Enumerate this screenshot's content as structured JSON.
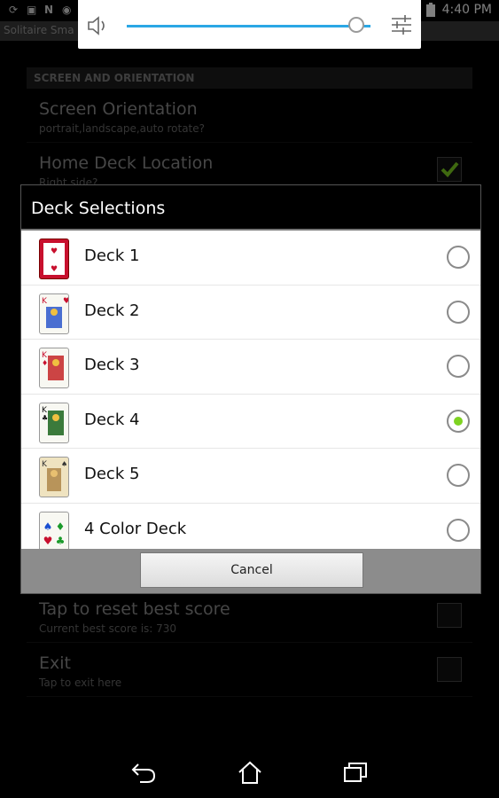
{
  "status_bar": {
    "time": "4:40 PM",
    "icons": [
      "sync-icon",
      "image-icon",
      "n-icon",
      "location-icon",
      "email-icon",
      "wifi-icon",
      "battery-icon"
    ]
  },
  "app": {
    "title": "Solitaire Sma"
  },
  "volume_panel": {
    "level": 0.9,
    "accent": "#2ba7e5",
    "icons": [
      "speaker-icon",
      "equalizer-settings-icon"
    ]
  },
  "background_settings": {
    "section_header": "SCREEN AND ORIENTATION",
    "items": [
      {
        "title": "Screen Orientation",
        "subtitle": "portrait,landscape,auto rotate?",
        "has_checkbox": false
      },
      {
        "title": "Home Deck Location",
        "subtitle": "Right side?",
        "has_checkbox": true,
        "checked": true
      },
      {
        "title": "Tap to reset best score",
        "subtitle": "Current best score is: 730",
        "has_checkbox": true,
        "checked": false
      },
      {
        "title": "Exit",
        "subtitle": "Tap to exit here",
        "has_checkbox": true,
        "checked": false
      }
    ]
  },
  "dialog": {
    "title": "Deck Selections",
    "decks": [
      {
        "label": "Deck 1",
        "selected": false,
        "card_icon": "card-hearts-icon"
      },
      {
        "label": "Deck 2",
        "selected": false,
        "card_icon": "card-king-icon"
      },
      {
        "label": "Deck 3",
        "selected": false,
        "card_icon": "card-king-icon"
      },
      {
        "label": "Deck 4",
        "selected": true,
        "card_icon": "card-king-clubs-icon"
      },
      {
        "label": "Deck 5",
        "selected": false,
        "card_icon": "card-king-vintage-icon"
      },
      {
        "label": "4 Color Deck",
        "selected": false,
        "card_icon": "card-four-color-icon"
      }
    ],
    "cancel_label": "Cancel",
    "selected_color": "#7ed321"
  },
  "nav_bar": {
    "icons": [
      "back-icon",
      "home-icon",
      "recents-icon"
    ]
  }
}
